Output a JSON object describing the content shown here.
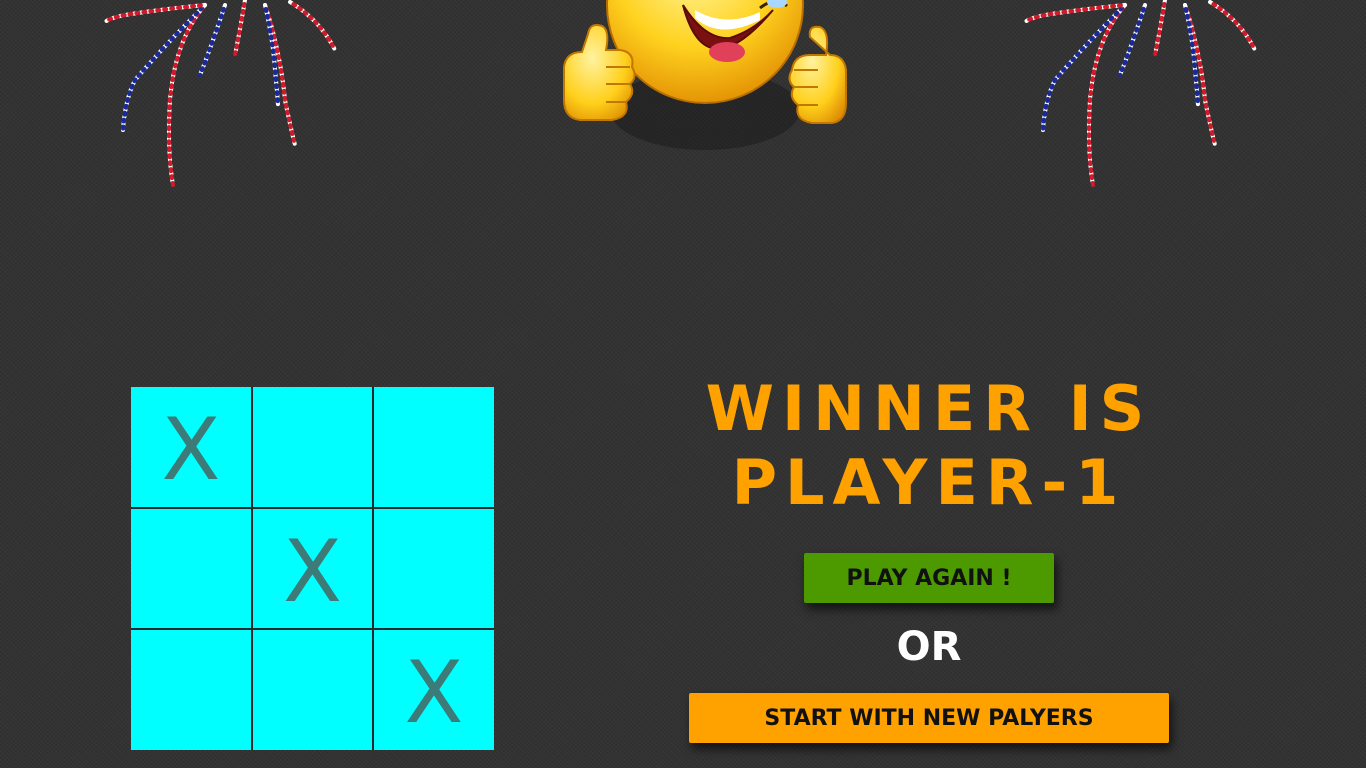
{
  "header": {
    "left_decoration": "firework",
    "center_decoration": "thumbs-up-smiley",
    "right_decoration": "firework"
  },
  "board": {
    "cells": [
      "X",
      "",
      "",
      "",
      "X",
      "",
      "",
      "",
      "X"
    ],
    "cell_color": "#00ffff",
    "mark_color": "#3c7b78"
  },
  "result": {
    "line1": "WINNER IS",
    "line2": "PLAYER-1",
    "color": "#ffa200"
  },
  "actions": {
    "play_again_label": "PLAY AGAIN !",
    "or_label": "OR",
    "new_players_label": "START WITH NEW PALYERS",
    "play_again_color": "#4c9a00",
    "new_players_color": "#ffa200"
  }
}
